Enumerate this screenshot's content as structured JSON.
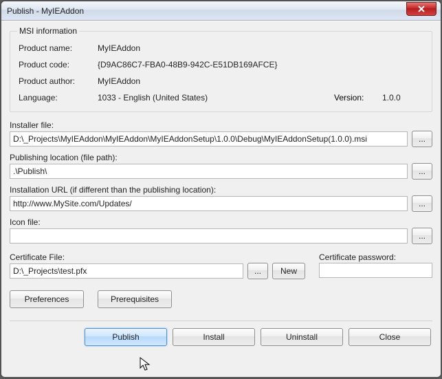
{
  "window": {
    "title": "Publish - MyIEAddon"
  },
  "msi": {
    "legend": "MSI information",
    "product_name_label": "Product name:",
    "product_name": "MyIEAddon",
    "product_code_label": "Product code:",
    "product_code": "{D9AC86C7-FBA0-48B9-942C-E51DB169AFCE}",
    "product_author_label": "Product author:",
    "product_author": "MyIEAddon",
    "language_label": "Language:",
    "language": "1033 - English (United States)",
    "version_label": "Version:",
    "version": "1.0.0"
  },
  "installer": {
    "label": "Installer file:",
    "value": "D:\\_Projects\\MyIEAddon\\MyIEAddon\\MyIEAddonSetup\\1.0.0\\Debug\\MyIEAddonSetup(1.0.0).msi"
  },
  "publishing": {
    "label": "Publishing location (file path):",
    "value": ".\\Publish\\"
  },
  "install_url": {
    "label": "Installation URL (if different than the publishing location):",
    "value": "http://www.MySite.com/Updates/"
  },
  "icon": {
    "label": "Icon file:",
    "value": ""
  },
  "certificate": {
    "label": "Certificate File:",
    "value": "D:\\_Projects\\test.pfx",
    "password_label": "Certificate password:",
    "password_value": ""
  },
  "buttons": {
    "browse": "...",
    "new": "New",
    "preferences": "Preferences",
    "prerequisites": "Prerequisites",
    "publish": "Publish",
    "install": "Install",
    "uninstall": "Uninstall",
    "close": "Close"
  }
}
